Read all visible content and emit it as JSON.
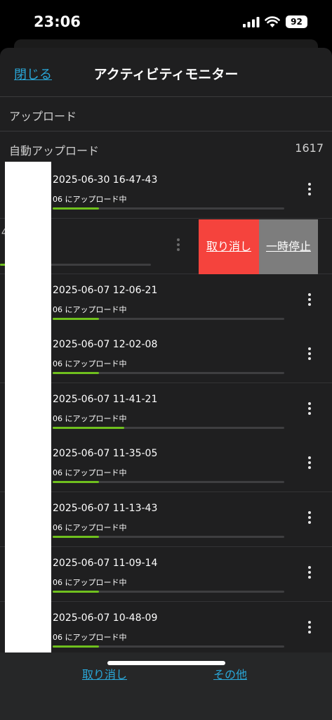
{
  "status": {
    "time": "23:06",
    "battery": "92",
    "icons": [
      "signal-icon",
      "wifi-icon",
      "battery-icon"
    ]
  },
  "nav": {
    "close": "閉じる",
    "title": "アクティビティモニター"
  },
  "sections": {
    "upload": "アップロード",
    "auto_upload": "自動アップロード",
    "auto_upload_count": "1617"
  },
  "rows": [
    {
      "title": "2025-06-30 16-47-43",
      "subtitle": "06 にアップロード中",
      "progress": 0.2
    },
    {
      "title": "",
      "subtitle": "",
      "progress": 0.18,
      "stub": "4",
      "swipe_cancel": "取り消し",
      "swipe_pause": "一時停止"
    },
    {
      "title": "2025-06-07 12-06-21",
      "subtitle": "06 にアップロード中",
      "progress": 0.2
    },
    {
      "title": "2025-06-07 12-02-08",
      "subtitle": "06 にアップロード中",
      "progress": 0.2
    },
    {
      "title": "2025-06-07 11-41-21",
      "subtitle": "06 にアップロード中",
      "progress": 0.31
    },
    {
      "title": "2025-06-07 11-35-05",
      "subtitle": "06 にアップロード中",
      "progress": 0.2
    },
    {
      "title": "2025-06-07 11-13-43",
      "subtitle": "06 にアップロード中",
      "progress": 0.2
    },
    {
      "title": "2025-06-07 11-09-14",
      "subtitle": "06 にアップロード中",
      "progress": 0.2
    },
    {
      "title": "2025-06-07 10-48-09",
      "subtitle": "06 にアップロード中",
      "progress": 0.2
    }
  ],
  "bottom": {
    "cancel": "取り消し",
    "other": "その他"
  },
  "colors": {
    "accent": "#2aa7d8",
    "progress": "#6fc01e",
    "cancel_action": "#f5433d",
    "pause_action": "#7d7d7d"
  }
}
